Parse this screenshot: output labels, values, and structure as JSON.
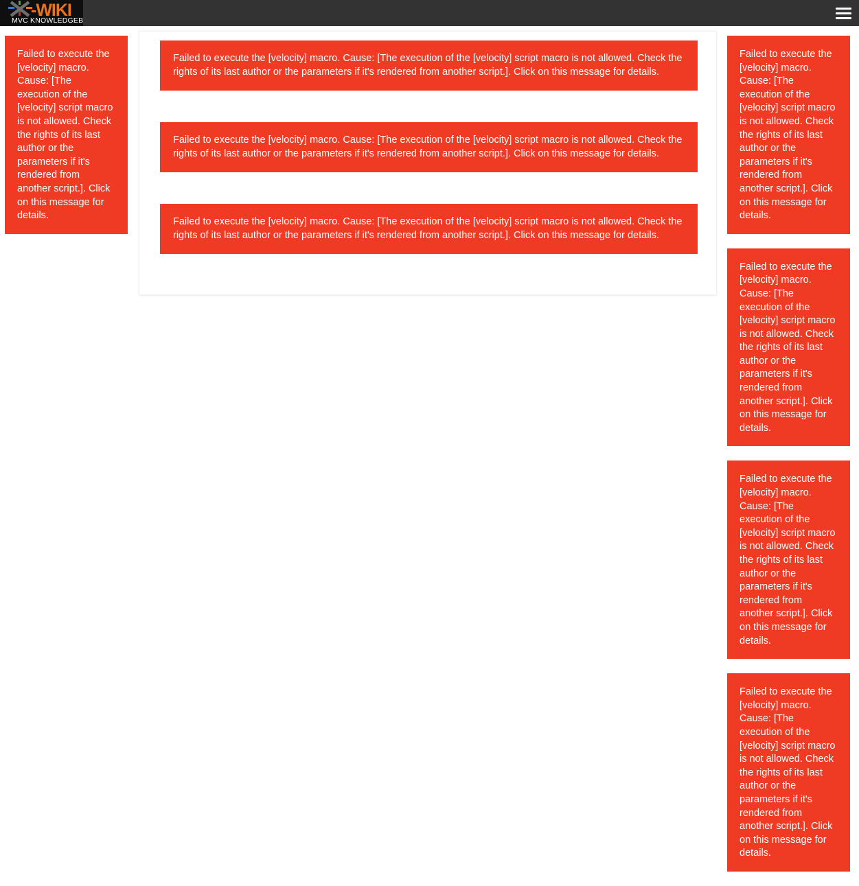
{
  "header": {
    "logo": {
      "name": "xwiki-logo",
      "brand_primary": "X-WIKI",
      "brand_x": "X",
      "brand_wiki": "-WIKI",
      "tagline": "MVC KNOWLEDGEBASE",
      "logo_bg": "#0f0f0f",
      "wiki_color": "#ef7215",
      "tagline_color": "#ffffff",
      "x_color": "#6e6e6e",
      "dash_blue": "#2e7dd1",
      "dash_green": "#5aa832",
      "dash_red": "#d42a2a",
      "dash_orange": "#ef7215"
    },
    "bar_color": "#333333",
    "menu_toggle_label": "Toggle navigation",
    "menu_icon": "hamburger-menu-icon"
  },
  "colors": {
    "error_bg": "#ef3b24",
    "error_text": "#ffffff",
    "page_bg": "#ffffff",
    "panel_border": "#f0f0f0"
  },
  "error_message": "Failed to execute the [velocity] macro. Cause: [The execution of the [velocity] script macro is not allowed. Check the rights of its last author or the parameters if it's rendered from another script.]. Click on this message for details.",
  "left_column": {
    "messages": [
      "Failed to execute the [velocity] macro. Cause: [The execution of the [velocity] script macro is not allowed. Check the rights of its last author or the parameters if it's rendered from another script.]. Click on this message for details."
    ]
  },
  "main_content": {
    "messages": [
      "Failed to execute the [velocity] macro. Cause: [The execution of the [velocity] script macro is not allowed. Check the rights of its last author or the parameters if it's rendered from another script.]. Click on this message for details.",
      "Failed to execute the [velocity] macro. Cause: [The execution of the [velocity] script macro is not allowed. Check the rights of its last author or the parameters if it's rendered from another script.]. Click on this message for details.",
      "Failed to execute the [velocity] macro. Cause: [The execution of the [velocity] script macro is not allowed. Check the rights of its last author or the parameters if it's rendered from another script.]. Click on this message for details."
    ]
  },
  "right_column": {
    "messages": [
      "Failed to execute the [velocity] macro. Cause: [The execution of the [velocity] script macro is not allowed. Check the rights of its last author or the parameters if it's rendered from another script.]. Click on this message for details.",
      "Failed to execute the [velocity] macro. Cause: [The execution of the [velocity] script macro is not allowed. Check the rights of its last author or the parameters if it's rendered from another script.]. Click on this message for details.",
      "Failed to execute the [velocity] macro. Cause: [The execution of the [velocity] script macro is not allowed. Check the rights of its last author or the parameters if it's rendered from another script.]. Click on this message for details.",
      "Failed to execute the [velocity] macro. Cause: [The execution of the [velocity] script macro is not allowed. Check the rights of its last author or the parameters if it's rendered from another script.]. Click on this message for details."
    ]
  }
}
